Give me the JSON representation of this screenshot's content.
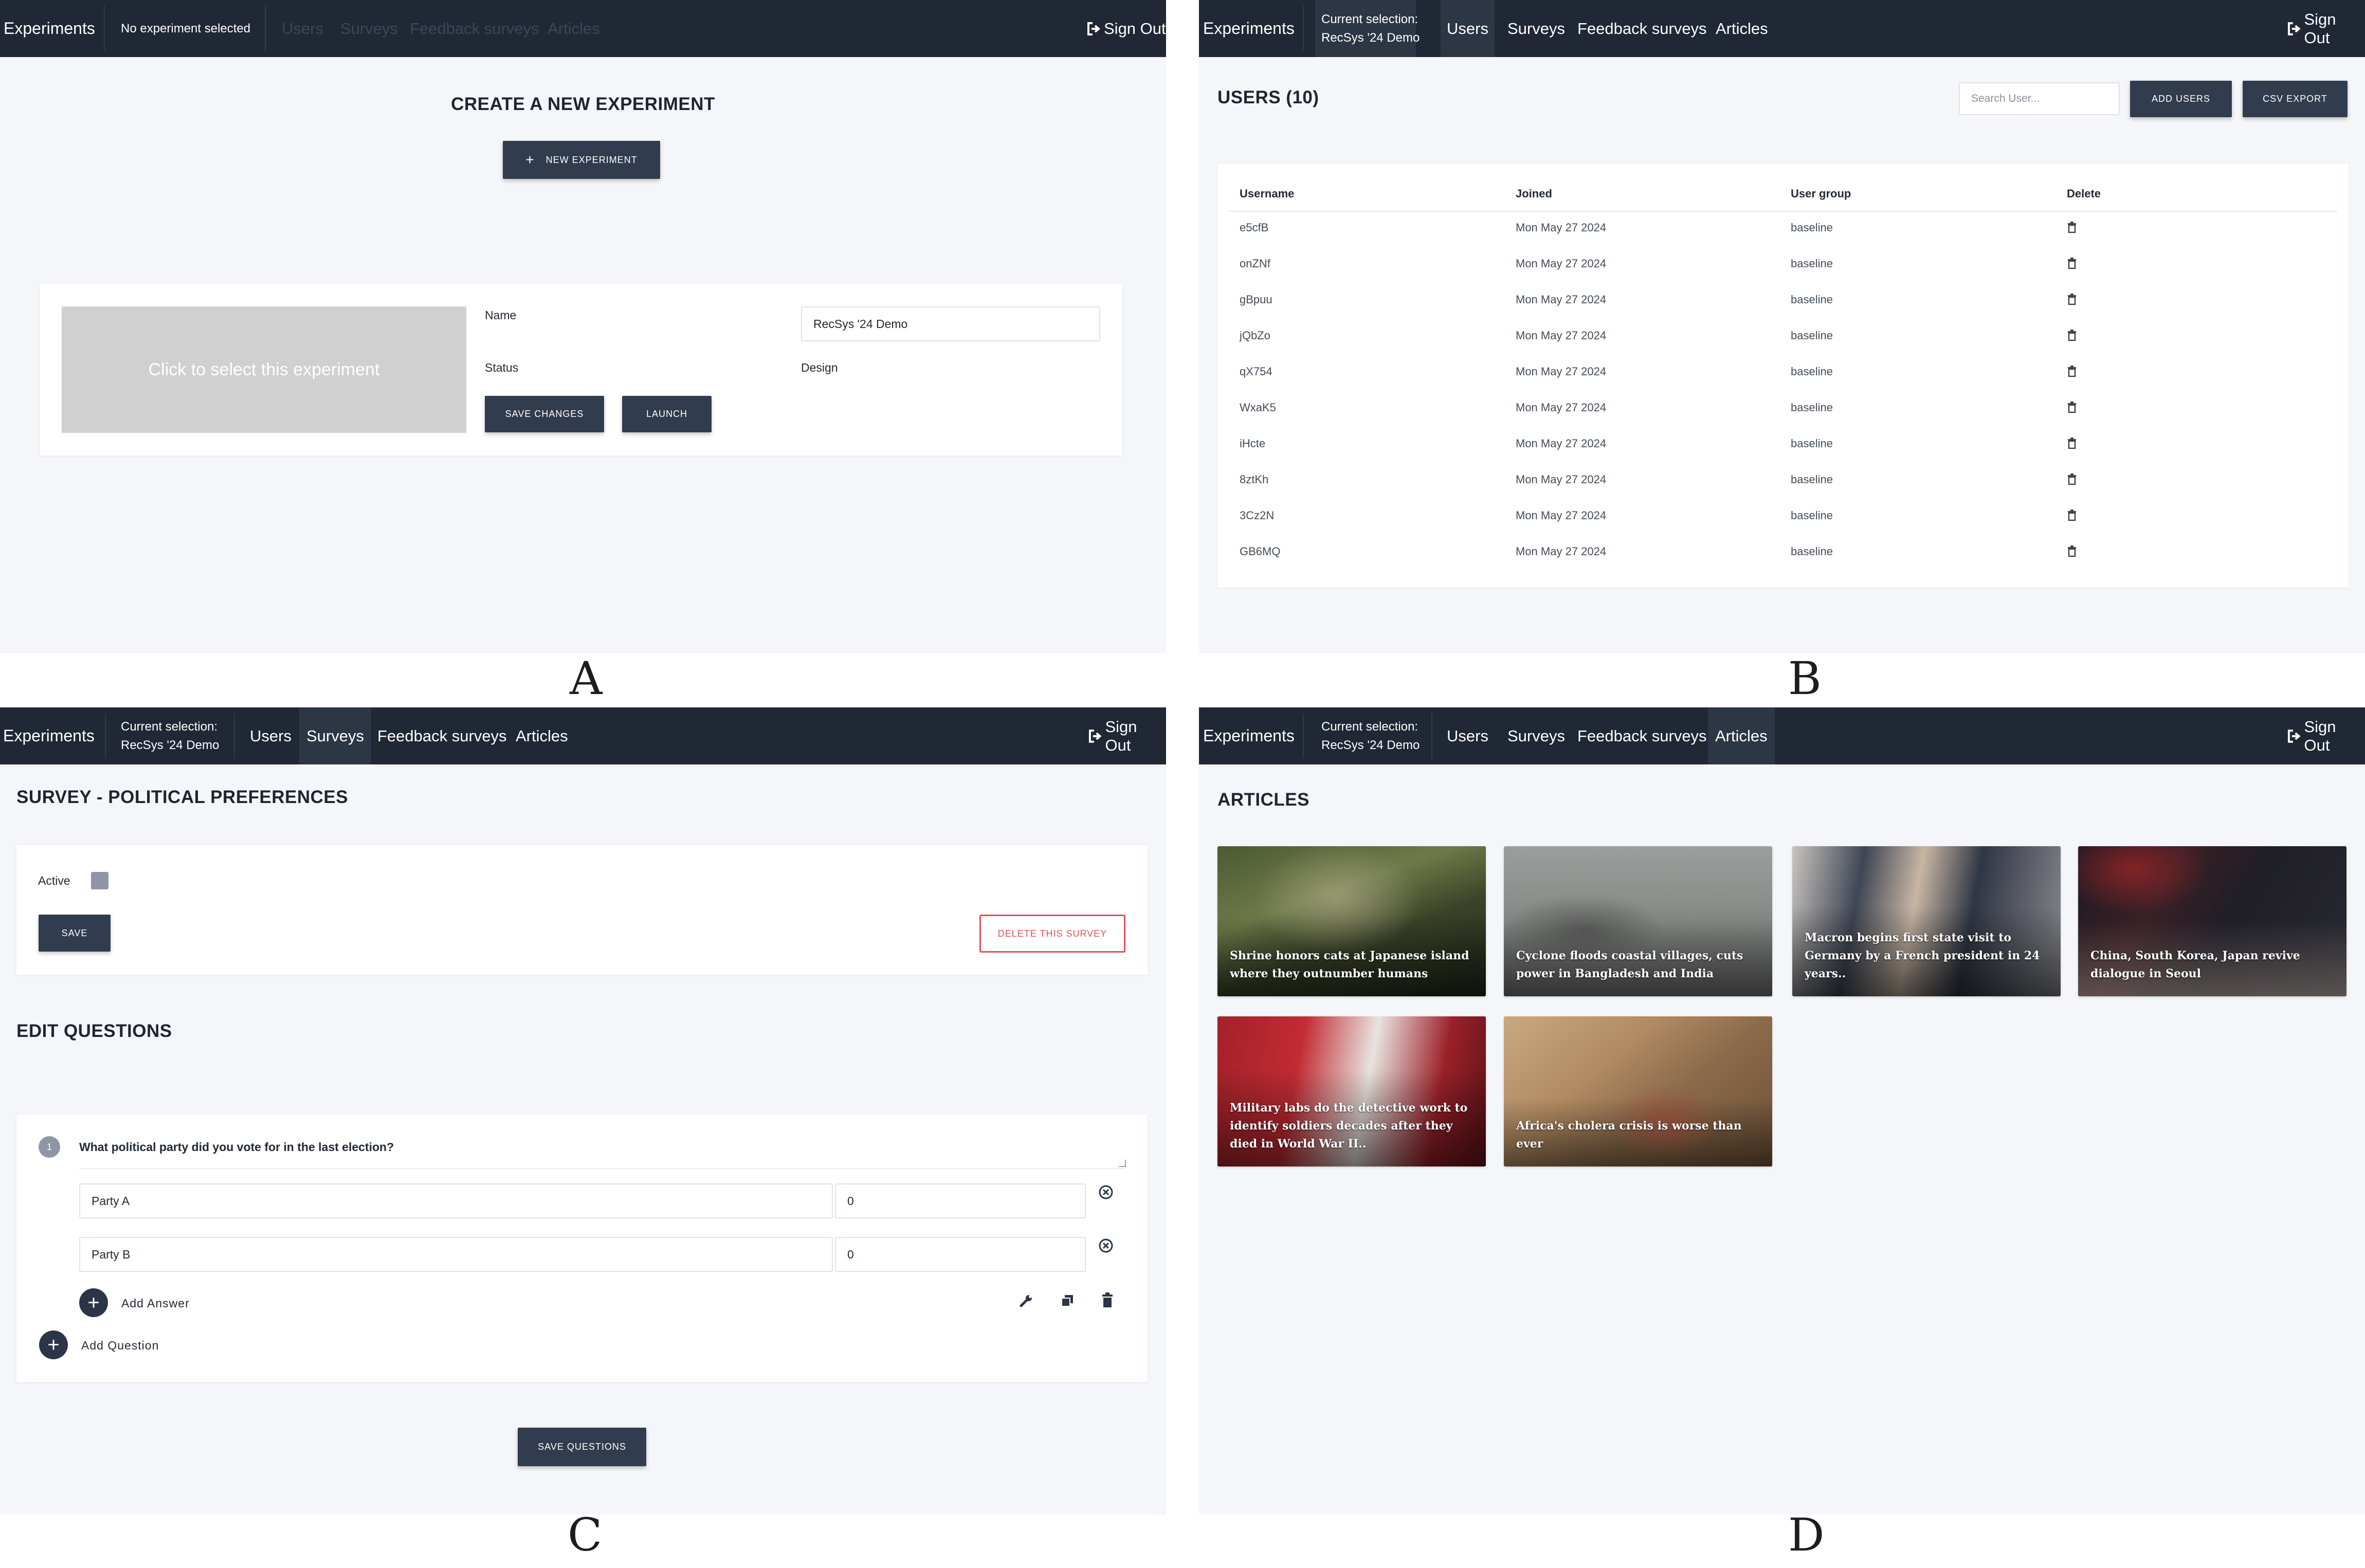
{
  "panels": {
    "a": {
      "letter": "A",
      "nav": {
        "brand": "Experiments",
        "selection": "No experiment selected",
        "users": "Users",
        "surveys": "Surveys",
        "feedback": "Feedback surveys",
        "articles": "Articles",
        "signout": "Sign Out"
      },
      "heading": "CREATE A NEW EXPERIMENT",
      "new_button": "NEW EXPERIMENT",
      "placeholder_text": "Click to select this experiment",
      "name_label": "Name",
      "name_value": "RecSys '24 Demo",
      "status_label": "Status",
      "design_label": "Design",
      "save_button": "SAVE CHANGES",
      "launch_button": "LAUNCH"
    },
    "b": {
      "letter": "B",
      "nav": {
        "brand": "Experiments",
        "selection_line1": "Current selection:",
        "selection_line2": "RecSys '24 Demo",
        "users": "Users",
        "surveys": "Surveys",
        "feedback": "Feedback surveys",
        "articles": "Articles",
        "signout": "Sign Out"
      },
      "heading": "USERS (10)",
      "search_placeholder": "Search User...",
      "add_users_button": "ADD USERS",
      "csv_button": "CSV EXPORT",
      "columns": [
        "Username",
        "Joined",
        "User group",
        "Delete"
      ],
      "rows": [
        {
          "username": "e5cfB",
          "joined": "Mon May 27 2024",
          "group": "baseline"
        },
        {
          "username": "onZNf",
          "joined": "Mon May 27 2024",
          "group": "baseline"
        },
        {
          "username": "gBpuu",
          "joined": "Mon May 27 2024",
          "group": "baseline"
        },
        {
          "username": "jQbZo",
          "joined": "Mon May 27 2024",
          "group": "baseline"
        },
        {
          "username": "qX754",
          "joined": "Mon May 27 2024",
          "group": "baseline"
        },
        {
          "username": "WxaK5",
          "joined": "Mon May 27 2024",
          "group": "baseline"
        },
        {
          "username": "iHcte",
          "joined": "Mon May 27 2024",
          "group": "baseline"
        },
        {
          "username": "8ztKh",
          "joined": "Mon May 27 2024",
          "group": "baseline"
        },
        {
          "username": "3Cz2N",
          "joined": "Mon May 27 2024",
          "group": "baseline"
        },
        {
          "username": "GB6MQ",
          "joined": "Mon May 27 2024",
          "group": "baseline"
        }
      ]
    },
    "c": {
      "letter": "C",
      "nav": {
        "brand": "Experiments",
        "selection_line1": "Current selection:",
        "selection_line2": "RecSys '24 Demo",
        "users": "Users",
        "surveys": "Surveys",
        "feedback": "Feedback surveys",
        "articles": "Articles",
        "signout": "Sign Out"
      },
      "heading": "SURVEY - POLITICAL PREFERENCES",
      "active_label": "Active",
      "save_button": "SAVE",
      "delete_button": "DELETE THIS SURVEY",
      "edit_heading": "EDIT QUESTIONS",
      "question_number": "1",
      "question_text": "What political party did you vote for in the last election?",
      "answers": [
        {
          "text": "Party A",
          "value": "0"
        },
        {
          "text": "Party B",
          "value": "0"
        }
      ],
      "add_answer": "Add Answer",
      "add_question": "Add Question",
      "save_questions_button": "SAVE QUESTIONS"
    },
    "d": {
      "letter": "D",
      "nav": {
        "brand": "Experiments",
        "selection_line1": "Current selection:",
        "selection_line2": "RecSys '24 Demo",
        "users": "Users",
        "surveys": "Surveys",
        "feedback": "Feedback surveys",
        "articles": "Articles",
        "signout": "Sign Out"
      },
      "heading": "ARTICLES",
      "articles": [
        {
          "title": "Shrine honors cats at Japanese island where they outnumber humans"
        },
        {
          "title": "Cyclone floods coastal villages, cuts power in Bangladesh and India"
        },
        {
          "title": "Macron begins first state visit to Germany by a French president in 24 years.."
        },
        {
          "title": "China, South Korea, Japan revive dialogue in Seoul"
        },
        {
          "title": "Military labs do the detective work to identify soldiers decades after they died in World War II.."
        },
        {
          "title": "Africa's cholera crisis is worse than ever"
        }
      ]
    }
  },
  "colors": {
    "navbar": "#202835",
    "button": "#323c4f",
    "background": "#f5f6f9",
    "danger": "#e0525a"
  }
}
